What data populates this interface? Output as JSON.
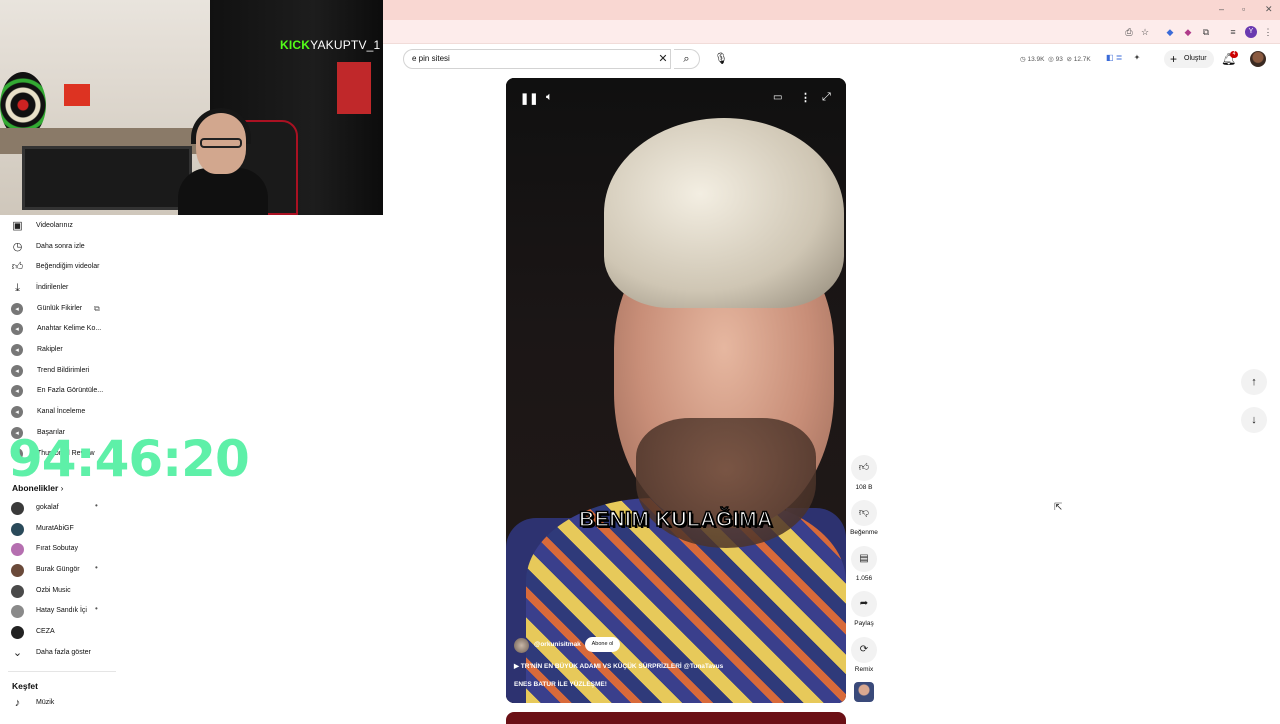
{
  "stream_overlay": {
    "kick_logo": "KICK",
    "channel": "YAKUPTV_1",
    "timer": "94:46:20"
  },
  "search": {
    "value": "e pin sitesi"
  },
  "header": {
    "stats": {
      "views": "13.9K",
      "videos": "93",
      "subscribers": "12.7K"
    },
    "create_label": "Oluştur",
    "notification_count": "4"
  },
  "sidebar": {
    "items": [
      {
        "label": "Videolarınız",
        "icon": "play-square-icon"
      },
      {
        "label": "Daha sonra izle",
        "icon": "clock-icon"
      },
      {
        "label": "Beğendiğim videolar",
        "icon": "thumbs-up-icon"
      },
      {
        "label": "İndirilenler",
        "icon": "download-icon"
      },
      {
        "label": "Günlük Fikirler",
        "icon": "extension-icon"
      },
      {
        "label": "Anahtar Kelime Ko...",
        "icon": "extension-icon"
      },
      {
        "label": "Rakipler",
        "icon": "extension-icon"
      },
      {
        "label": "Trend Bildirimleri",
        "icon": "extension-icon"
      },
      {
        "label": "En Fazla Görüntüle...",
        "icon": "extension-icon"
      },
      {
        "label": "Kanal İnceleme",
        "icon": "extension-icon"
      },
      {
        "label": "Başarılar",
        "icon": "extension-icon"
      },
      {
        "label": "Thumbnail Review",
        "icon": "extension-icon"
      }
    ],
    "subscriptions_heading": "Abonelikler",
    "subscriptions": [
      {
        "label": "gokalaf",
        "new": true,
        "color": "#3a3a3a"
      },
      {
        "label": "MuratAbiGF",
        "new": false,
        "color": "#2a4a5a"
      },
      {
        "label": "Fırat Sobutay",
        "new": false,
        "color": "#b56fb0"
      },
      {
        "label": "Burak Güngör",
        "new": true,
        "color": "#6a4a3a"
      },
      {
        "label": "Ozbi Music",
        "new": false,
        "color": "#4a4a4a"
      },
      {
        "label": "Hatay Sandık İçi",
        "new": true,
        "color": "#8a8a8a"
      },
      {
        "label": "CEZA",
        "new": false,
        "color": "#222222"
      }
    ],
    "show_more_label": "Daha fazla göster",
    "explore_heading": "Keşfet",
    "explore_items": [
      {
        "label": "Müzik",
        "icon": "music-note-icon"
      }
    ]
  },
  "video": {
    "caption": "BENIM KULAĞIMA",
    "channel_handle": "@orkunisitmak",
    "subscribe_label": "Abone ol",
    "title": "▶ TR'NİN EN BÜYÜK ADAMI VS KÜÇÜK SÜRPRİZLERİ @TunaTavus",
    "subtitle": "ENES BATUR İLE YÜZLEŞME!"
  },
  "actions": {
    "likes": "108 B",
    "dislike_label": "Beğenme",
    "comments": "1.056",
    "share_label": "Paylaş",
    "remix_label": "Remix"
  },
  "colors": {
    "tab_bar": "#f9d7d2",
    "timer": "#5ef0a8",
    "kick_green": "#53fc18"
  }
}
